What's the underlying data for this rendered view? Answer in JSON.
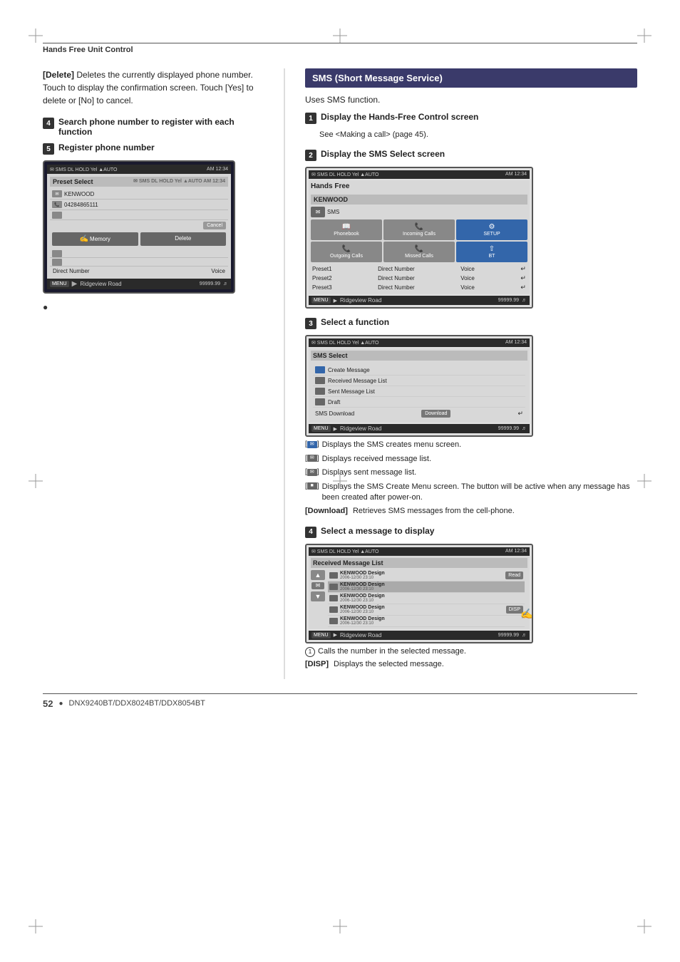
{
  "page": {
    "title": "Hands Free Unit Control",
    "footer_page_num": "52",
    "footer_bullet": "●",
    "footer_model": "DNX9240BT/DDX8024BT/DDX8054BT"
  },
  "left_section": {
    "delete_note": {
      "label": "[Delete]",
      "text": "Deletes the currently displayed phone number. Touch to display the confirmation screen. Touch [Yes] to delete or [No] to cancel."
    },
    "step4": {
      "num": "4",
      "label": "Search phone number to register with each function"
    },
    "step5": {
      "num": "5",
      "label": "Register phone number"
    },
    "preset_screen": {
      "title": "Preset Select",
      "topbar_left": "SMS DL HOLD Yel  AUTO",
      "topbar_right": "AM 12:34",
      "row1_name": "KENWOOD",
      "row2_phone": "04284865111",
      "cancel_btn": "Cancel",
      "memory_btn": "Memory",
      "delete_btn": "Delete",
      "direct_label": "Direct Number",
      "voice_label": "Voice",
      "bottom_menu": "MENU",
      "bottom_road": "Ridgeview Road",
      "bottom_mileage": "99999.99"
    }
  },
  "right_section": {
    "sms_header": "SMS (Short Message Service)",
    "uses_text": "Uses SMS function.",
    "step1": {
      "num": "1",
      "label": "Display the Hands-Free Control screen",
      "desc": "See <Making a call> (page 45)."
    },
    "step2": {
      "num": "2",
      "label": "Display the SMS Select screen",
      "hands_free_screen": {
        "title": "Hands Free",
        "topbar": "SMS DL HOLD Yel  AUTO  AM 12:34",
        "kenwood": "KENWOOD",
        "grid_items": [
          "Phonebook",
          "Incoming Calls",
          "SETUP",
          "Outgoing Calls",
          "Missed Calls",
          "BT"
        ],
        "preset1_label": "Preset1",
        "preset1_direct": "Direct Number",
        "preset1_voice": "Voice",
        "preset2_label": "Preset2",
        "preset2_direct": "Direct Number",
        "preset2_voice": "Voice",
        "preset3_label": "Preset3",
        "preset3_direct": "Direct Number",
        "preset3_voice": "Voice",
        "bottom_road": "Ridgeview Road",
        "bottom_mileage": "99999.99"
      }
    },
    "step3": {
      "num": "3",
      "label": "Select a function",
      "sms_select_screen": {
        "title": "SMS Select",
        "topbar": "SMS DL HOLD Yel  AUTO  AM 12:34",
        "items": [
          "Create Message",
          "Received Message List",
          "Sent Message List",
          "Draft"
        ],
        "sms_download_label": "SMS Download",
        "download_btn": "Download",
        "bottom_road": "Ridgeview Road",
        "bottom_mileage": "99999.99"
      },
      "func_descs": [
        {
          "icon": "[  ]",
          "text": "Displays the SMS creates menu screen."
        },
        {
          "icon": "[  ]",
          "text": "Displays received message list."
        },
        {
          "icon": "[  ]",
          "text": "Displays sent message list."
        },
        {
          "icon": "[  ]",
          "text": "Displays the SMS Create Menu screen. The button will be active when any message has been created after power-on."
        },
        {
          "label": "[Download]",
          "text": "Retrieves SMS messages from the cell-phone."
        }
      ]
    },
    "step4": {
      "num": "4",
      "label": "Select a message to display",
      "recv_screen": {
        "title": "Received Message List",
        "topbar": "SMS DL HOLD Yel  AUTO  AM 12:34",
        "items": [
          {
            "sender": "KENWOOD Design",
            "date": "2006-12/30 23:10"
          },
          {
            "sender": "KENWOOD Design",
            "date": "2006-12/30 23:10"
          },
          {
            "sender": "KENWOOD Design",
            "date": "2006-12/30 23:10"
          },
          {
            "sender": "KENWOOD Design",
            "date": "2006-12/30 23:10"
          },
          {
            "sender": "KENWOOD Design",
            "date": "2006-12/30 23:10"
          }
        ],
        "read_btn": "Read",
        "disp_btn": "DISP",
        "bottom_road": "Ridgeview Road",
        "bottom_mileage": "99999.99"
      },
      "descs": [
        {
          "marker": "1",
          "text": "Calls the number in the selected message."
        },
        {
          "marker": "[DISP]",
          "text": "Displays the selected message."
        }
      ]
    }
  }
}
